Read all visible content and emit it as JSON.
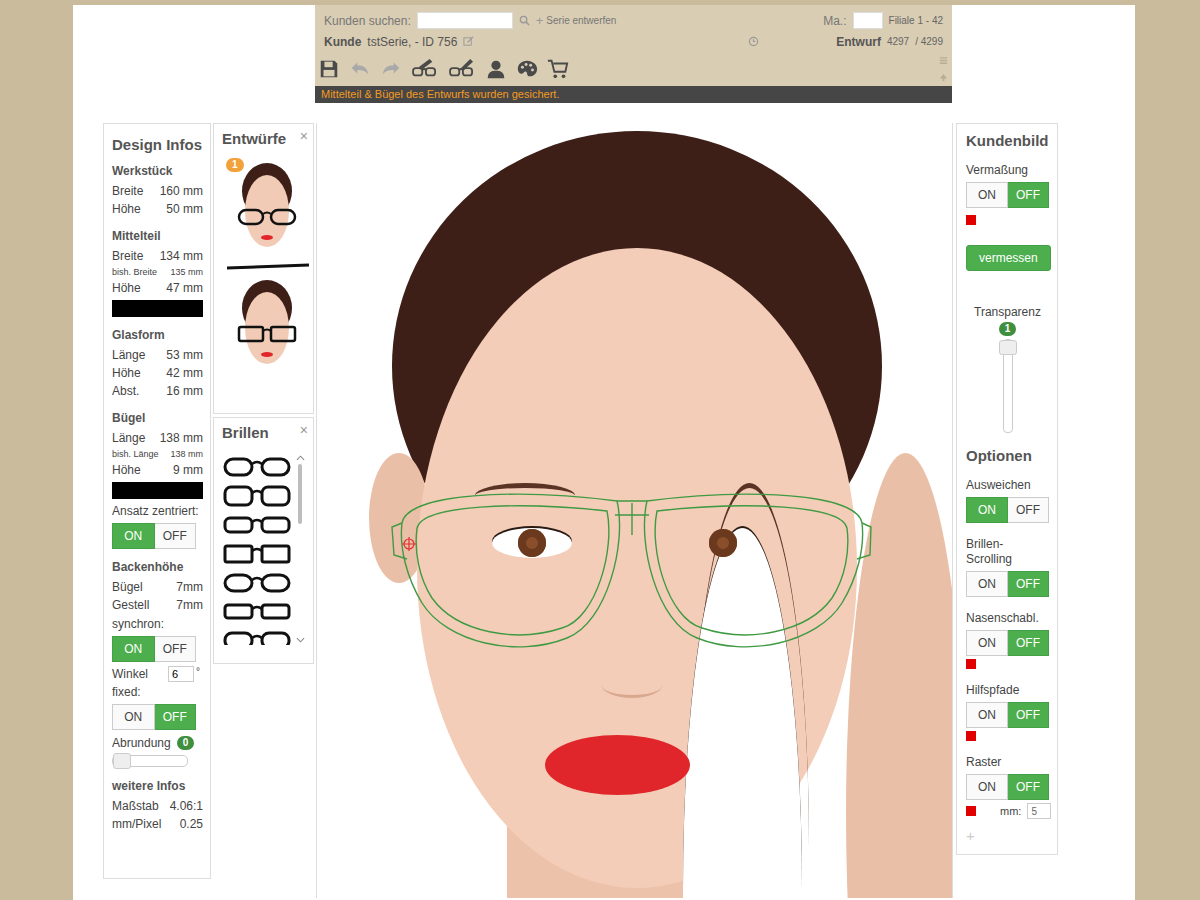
{
  "header": {
    "search_label": "Kunden suchen:",
    "search_value": "",
    "new_series": {
      "icon": "+",
      "label": "Serie entwerfen"
    },
    "ma_label": "Ma.:",
    "ma_value": "",
    "branch": "Filiale 1 - 42",
    "customer_label": "Kunde",
    "customer": "tstSerie, - ID 756",
    "draft_label": "Entwurf",
    "draft_current": "4297",
    "draft_total": "/ 4299",
    "tools": [
      {
        "disabled": false
      },
      {
        "disabled": true
      },
      {
        "disabled": true
      },
      {
        "disabled": false
      },
      {
        "disabled": false
      },
      {
        "disabled": false
      },
      {
        "disabled": false
      },
      {
        "disabled": false
      }
    ],
    "message": "Mittelteil & Bügel des Entwurfs wurden gesichert."
  },
  "design": {
    "title": "Design Infos",
    "items": [
      {
        "kind": "heading",
        "text": "Werkstück"
      },
      {
        "kind": "row",
        "label": "Breite",
        "value": "160 mm"
      },
      {
        "kind": "row",
        "label": "Höhe",
        "value": "50 mm"
      },
      {
        "kind": "heading",
        "text": "Mittelteil"
      },
      {
        "kind": "row",
        "label": "Breite",
        "value": "134 mm"
      },
      {
        "kind": "small-row",
        "label": "bish. Breite",
        "value": "135 mm"
      },
      {
        "kind": "row",
        "label": "Höhe",
        "value": "47 mm"
      },
      {
        "kind": "swatch",
        "color": "#000000"
      },
      {
        "kind": "heading",
        "text": "Glasform"
      },
      {
        "kind": "row",
        "label": "Länge",
        "value": "53 mm"
      },
      {
        "kind": "row",
        "label": "Höhe",
        "value": "42 mm"
      },
      {
        "kind": "row",
        "label": "Abst.",
        "value": "16 mm"
      },
      {
        "kind": "heading",
        "text": "Bügel"
      },
      {
        "kind": "row",
        "label": "Länge",
        "value": "138 mm"
      },
      {
        "kind": "small-row",
        "label": "bish. Länge",
        "value": "138 mm"
      },
      {
        "kind": "row",
        "label": "Höhe",
        "value": "9 mm"
      },
      {
        "kind": "swatch",
        "color": "#000000"
      },
      {
        "kind": "label",
        "text": "Ansatz zentriert:"
      },
      {
        "kind": "toggle",
        "options": [
          {
            "label": "ON",
            "selected": true
          },
          {
            "label": "OFF",
            "selected": false
          }
        ]
      },
      {
        "kind": "heading",
        "text": "Backenhöhe"
      },
      {
        "kind": "row",
        "label": "Bügel",
        "value": "7mm"
      },
      {
        "kind": "row",
        "label": "Gestell",
        "value": "7mm"
      },
      {
        "kind": "label",
        "text": "synchron:"
      },
      {
        "kind": "toggle",
        "options": [
          {
            "label": "ON",
            "selected": true
          },
          {
            "label": "OFF",
            "selected": false
          }
        ]
      },
      {
        "kind": "input-row",
        "label": "Winkel",
        "value": "6",
        "unit": "°"
      },
      {
        "kind": "label",
        "text": "fixed:"
      },
      {
        "kind": "toggle",
        "options": [
          {
            "label": "ON",
            "selected": false
          },
          {
            "label": "OFF",
            "selected": true
          }
        ]
      },
      {
        "kind": "slider",
        "label": "Abrundung",
        "badge": "0",
        "level": 0
      },
      {
        "kind": "heading",
        "text": "weitere Infos"
      },
      {
        "kind": "row",
        "label": "Maßstab",
        "value": "4.06:1"
      },
      {
        "kind": "row",
        "label": "mm/Pixel",
        "value": "0.25"
      }
    ]
  },
  "drafts": {
    "title": "Entwürfe",
    "close": "×",
    "items": [
      {
        "badge": "1",
        "selected": true
      },
      {
        "badge": "",
        "selected": false
      }
    ]
  },
  "glasses": {
    "title": "Brillen",
    "close": "×",
    "items": [
      {
        "selected": false
      },
      {
        "selected": false
      },
      {
        "selected": false
      },
      {
        "selected": false
      },
      {
        "selected": false
      },
      {
        "selected": false
      },
      {
        "selected": false
      }
    ],
    "scrollbar": {
      "level": 0
    }
  },
  "customer_image": {
    "title": "Kundenbild",
    "items": [
      {
        "kind": "toggle",
        "label": "Vermaßung",
        "options": [
          {
            "label": "ON",
            "selected": false
          },
          {
            "label": "OFF",
            "selected": true
          }
        ],
        "marker": "#e00000"
      },
      {
        "kind": "button",
        "label": "vermessen"
      },
      {
        "kind": "vslider",
        "label": "Transparenz",
        "badge": "1",
        "level": 1
      }
    ]
  },
  "options": {
    "title": "Optionen",
    "add": "+",
    "items": [
      {
        "kind": "toggle",
        "label": "Ausweichen",
        "options": [
          {
            "label": "ON",
            "selected": true
          },
          {
            "label": "OFF",
            "selected": false
          }
        ],
        "marker": null
      },
      {
        "kind": "toggle",
        "label": "Brillen-Scrolling",
        "options": [
          {
            "label": "ON",
            "selected": false
          },
          {
            "label": "OFF",
            "selected": true
          }
        ],
        "marker": null
      },
      {
        "kind": "toggle",
        "label": "Nasenschabl.",
        "options": [
          {
            "label": "ON",
            "selected": false
          },
          {
            "label": "OFF",
            "selected": true
          }
        ],
        "marker": "#e00000"
      },
      {
        "kind": "toggle",
        "label": "Hilfspfade",
        "options": [
          {
            "label": "ON",
            "selected": false
          },
          {
            "label": "OFF",
            "selected": true
          }
        ],
        "marker": "#e00000"
      },
      {
        "kind": "toggle",
        "label": "Raster",
        "options": [
          {
            "label": "ON",
            "selected": false
          },
          {
            "label": "OFF",
            "selected": true
          }
        ],
        "marker": "#e00000",
        "field_label": "mm:",
        "field_value": "5"
      }
    ]
  }
}
